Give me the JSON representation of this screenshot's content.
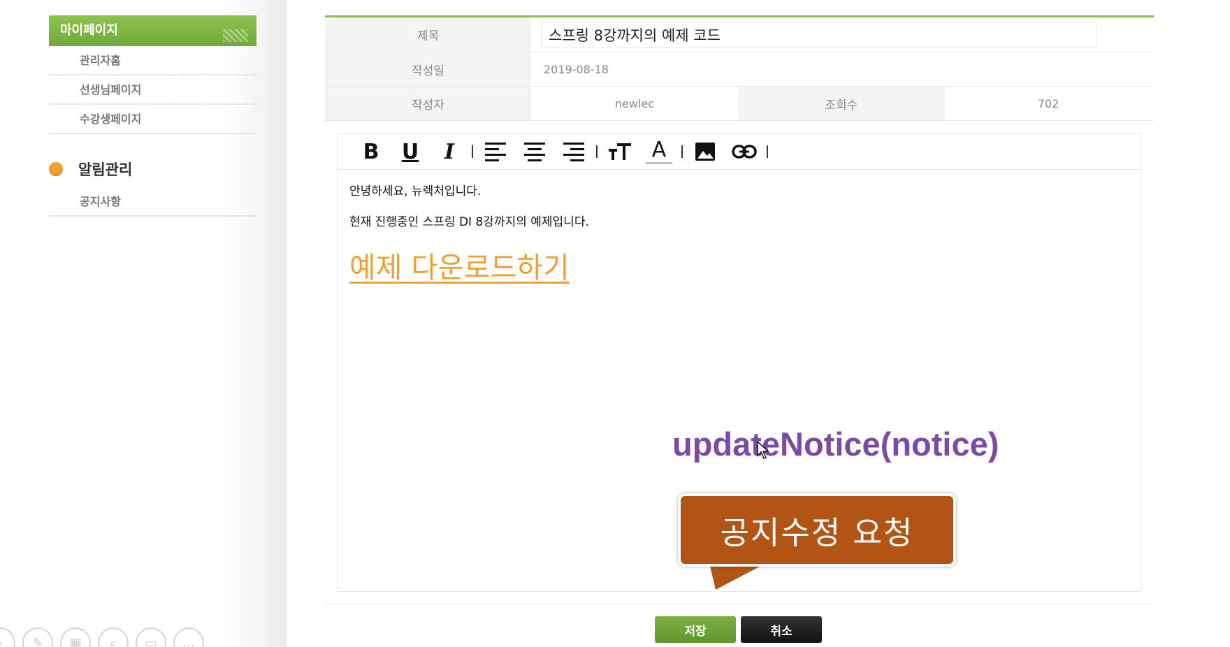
{
  "sidebar": {
    "title": "마이페이지",
    "items": [
      "관리자홈",
      "선생님페이지",
      "수강생페이지"
    ],
    "section": "알림관리",
    "section_items": [
      "공지사항"
    ]
  },
  "notice": {
    "title_label": "제목",
    "title_value": "스프링 8강까지의 예제 코드",
    "date_label": "작성일",
    "date_value": "2019-08-18",
    "writer_label": "작성자",
    "writer_value": "newlec",
    "hit_label": "조회수",
    "hit_value": "702"
  },
  "editor": {
    "toolbar": [
      "B",
      "U",
      "I",
      "align-left",
      "align-center",
      "align-right",
      "font-size",
      "A",
      "image",
      "link"
    ],
    "line1": "안녕하세요, 뉴렉처입니다.",
    "line2": "현재 진행중인 스프링 DI 8강까지의 예제입니다.",
    "link_text": "예제 다운로드하기",
    "link_color": "#f0a032"
  },
  "annotation": {
    "method": "updateNotice(notice)",
    "callout": "공지수정 요청",
    "callout_color": "#b15414"
  },
  "buttons": {
    "save": "저장",
    "cancel": "취소"
  },
  "colors": {
    "accent": "#8cc04c",
    "section_dot": "#f0a32a",
    "method_text": "#7b4aa5"
  }
}
